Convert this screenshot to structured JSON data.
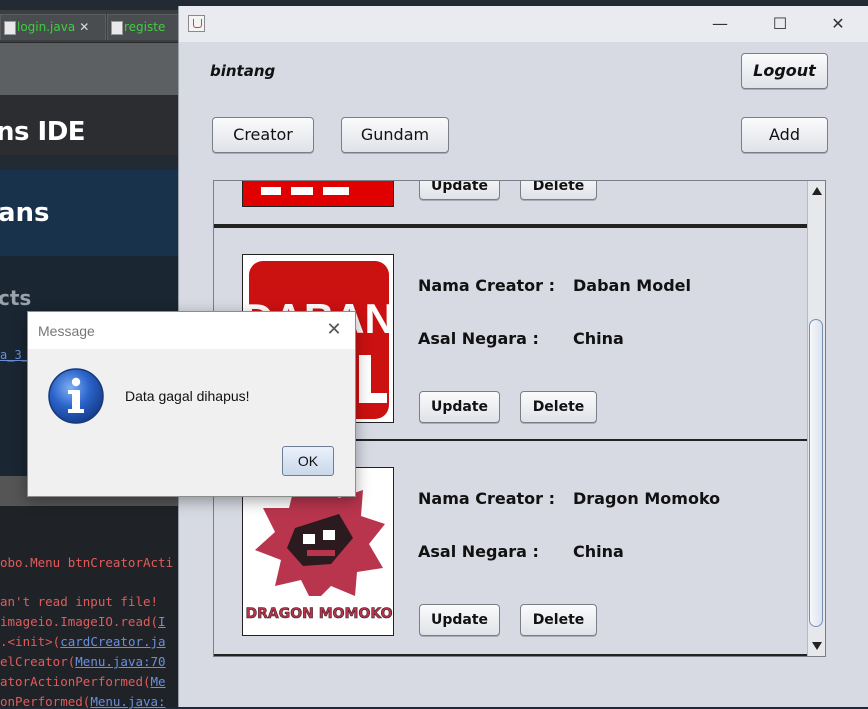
{
  "ide": {
    "tabs": [
      {
        "label": "login.java",
        "close": "✕"
      },
      {
        "label": "registe",
        "close": ""
      }
    ],
    "hero_text": "ns IDE",
    "banner_text": "ans",
    "projects_text": "cts",
    "project_link": "a_3_",
    "console_lines": [
      {
        "text": "obo.Menu btnCreatorActi",
        "link": ""
      },
      {
        "text": "an't read input file!",
        "link": ""
      },
      {
        "text": "imageio.ImageIO.read(",
        "link": "I"
      },
      {
        "text": ".<init>(",
        "link": "cardCreator.ja"
      },
      {
        "text": "elCreator(",
        "link": "Menu.java:70"
      },
      {
        "text": "atorActionPerformed(",
        "link": "Me"
      },
      {
        "text": "onPerformed(",
        "link": "Menu.java:"
      }
    ]
  },
  "frame": {
    "window_controls": {
      "minimize": "—",
      "maximize": "☐",
      "close": "✕"
    },
    "username": "bintang",
    "logout_label": "Logout",
    "creator_label": "Creator",
    "gundam_label": "Gundam",
    "add_label": "Add",
    "cards": [
      {
        "nama_label": "Nama Creator :",
        "nama": "",
        "asal_label": "Asal Negara :",
        "asal": "",
        "update": "Update",
        "delete": "Delete"
      },
      {
        "nama_label": "Nama Creator :",
        "nama": "Daban Model",
        "asal_label": "Asal Negara :",
        "asal": "China",
        "update": "Update",
        "delete": "Delete",
        "logo_text": "DABAN"
      },
      {
        "nama_label": "Nama Creator :",
        "nama": "Dragon Momoko",
        "asal_label": "Asal Negara :",
        "asal": "China",
        "update": "Update",
        "delete": "Delete",
        "logo_text": "DRAGON MOMOKO"
      }
    ]
  },
  "dialog": {
    "title": "Message",
    "close": "✕",
    "message": "Data gagal dihapus!",
    "ok_label": "OK"
  },
  "colors": {
    "frame_bg": "#d7dae3",
    "daban_red": "#cc1111",
    "momoko_red": "#b8354d",
    "info_blue": "#2a63c9"
  },
  "icons": [
    "java-icon",
    "info-icon",
    "file-icon",
    "close-icon",
    "minimize-icon",
    "maximize-icon"
  ]
}
